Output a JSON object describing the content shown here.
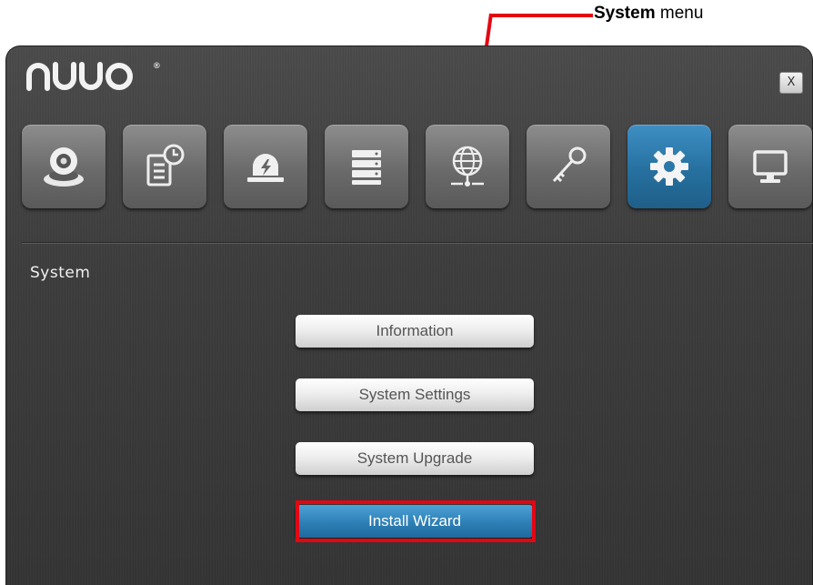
{
  "annotation": {
    "label_bold": "System",
    "label_rest": " menu",
    "color": "#e30613"
  },
  "window": {
    "logo": "nuuo",
    "logo_mark": "®",
    "close_label": "X"
  },
  "toolbar": {
    "items": [
      {
        "name": "camera",
        "icon": "webcam-icon",
        "active": false
      },
      {
        "name": "schedule",
        "icon": "schedule-document-icon",
        "active": false
      },
      {
        "name": "event",
        "icon": "alarm-light-icon",
        "active": false
      },
      {
        "name": "storage",
        "icon": "storage-stack-icon",
        "active": false
      },
      {
        "name": "network",
        "icon": "network-globe-icon",
        "active": false
      },
      {
        "name": "user-access",
        "icon": "key-icon",
        "active": false
      },
      {
        "name": "system",
        "icon": "gear-icon",
        "active": true
      },
      {
        "name": "display",
        "icon": "monitor-icon",
        "active": false
      }
    ],
    "active_color": "#2a77a8"
  },
  "section": {
    "title": "System"
  },
  "menu": {
    "buttons": [
      {
        "label": "Information"
      },
      {
        "label": "System Settings"
      },
      {
        "label": "System Upgrade"
      },
      {
        "label": "Install Wizard",
        "highlighted": true
      }
    ]
  }
}
